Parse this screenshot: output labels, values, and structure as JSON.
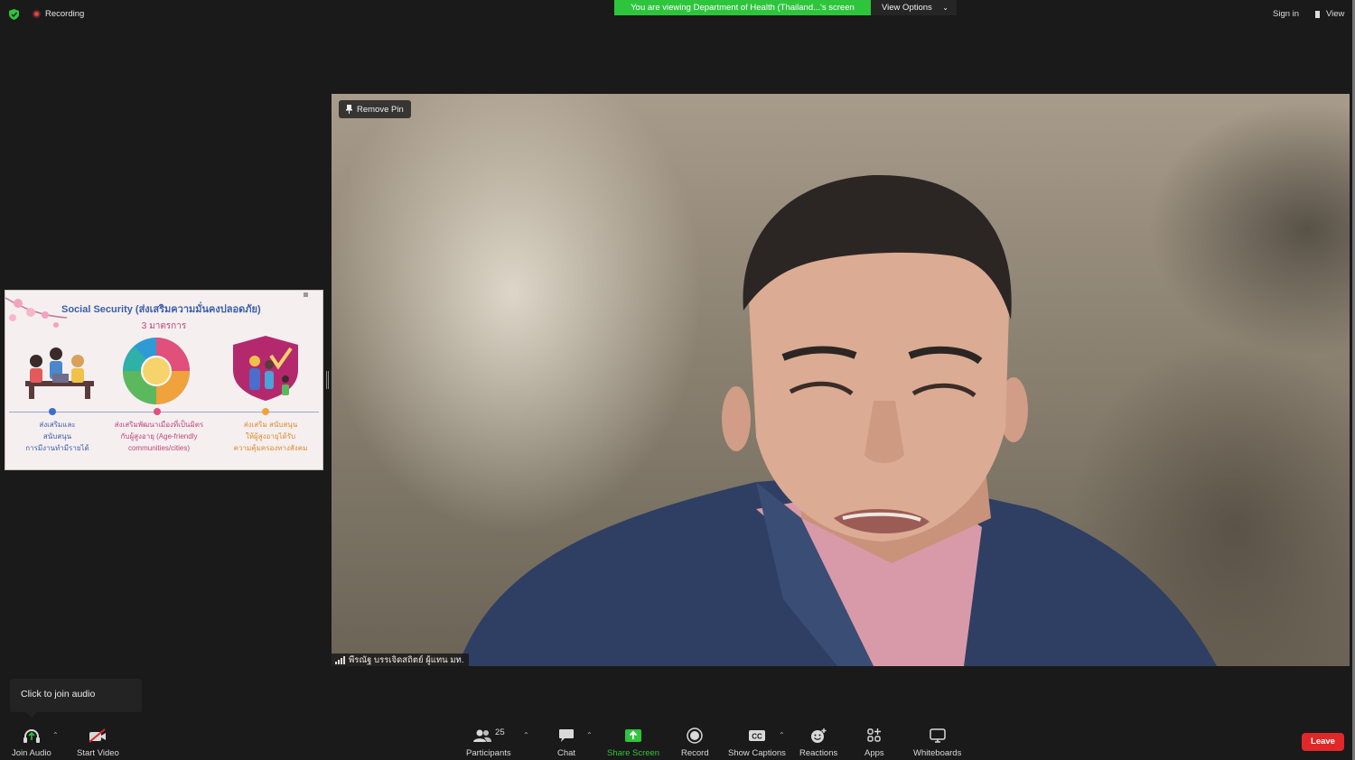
{
  "top": {
    "recording": "Recording",
    "viewing_banner": "You are viewing Department of Health (Thailand...'s screen",
    "view_options": "View Options",
    "sign_in": "Sign in",
    "view": "View"
  },
  "video": {
    "remove_pin": "Remove Pin",
    "participant_name": "พีรณัฐ บรรเจิดสถิตย์ ผู้แทน มท."
  },
  "slide": {
    "title": "Social Security (ส่งเสริมความมั่นคงปลอดภัย)",
    "subtitle": "3 มาตรการ",
    "captions": [
      "ส่งเสริมและ\nสนับสนุน\nการมีงานทำมีรายได้",
      "ส่งเสริมพัฒนาเมืองที่เป็นมิตร\nกับผู้สูงอายุ (Age-friendly\ncommunities/cities)",
      "ส่งเสริม สนับสนุน\nให้ผู้สูงอายุได้รับ\nความคุ้มครองทางสังคม"
    ]
  },
  "tooltip": {
    "join_audio": "Click to join audio"
  },
  "toolbar": {
    "join_audio": "Join Audio",
    "start_video": "Start Video",
    "participants": "Participants",
    "participants_count": "25",
    "chat": "Chat",
    "share_screen": "Share Screen",
    "record": "Record",
    "show_captions": "Show Captions",
    "reactions": "Reactions",
    "apps": "Apps",
    "whiteboards": "Whiteboards",
    "leave": "Leave"
  },
  "colors": {
    "banner_green": "#2ec53d",
    "share_green": "#2ec53d",
    "leave_red": "#e02828",
    "recording_red": "#e0463c"
  }
}
